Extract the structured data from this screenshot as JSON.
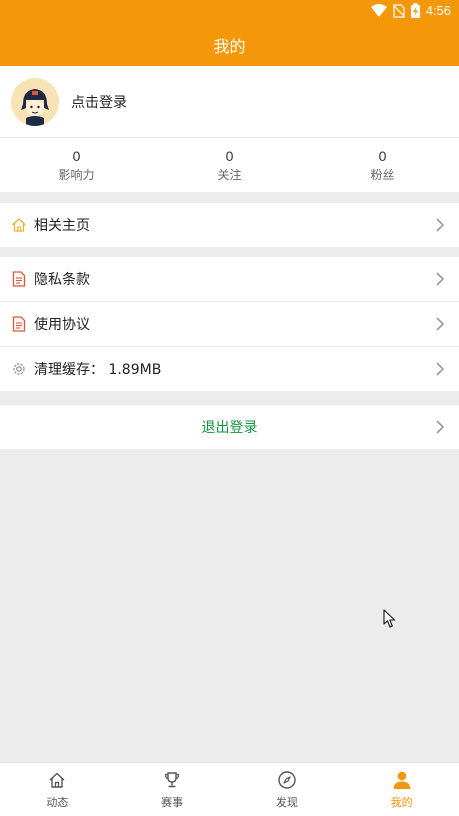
{
  "status_bar": {
    "time": "4:56"
  },
  "header": {
    "title": "我的"
  },
  "profile": {
    "login_prompt": "点击登录"
  },
  "stats": [
    {
      "value": "0",
      "label": "影响力"
    },
    {
      "value": "0",
      "label": "关注"
    },
    {
      "value": "0",
      "label": "粉丝"
    }
  ],
  "menu": {
    "homepage": "相关主页",
    "privacy": "隐私条款",
    "agreement": "使用协议",
    "cache": "清理缓存： 1.89MB",
    "logout": "退出登录"
  },
  "tabs": [
    {
      "label": "动态",
      "icon": "home-icon"
    },
    {
      "label": "赛事",
      "icon": "trophy-icon"
    },
    {
      "label": "发现",
      "icon": "compass-icon"
    },
    {
      "label": "我的",
      "icon": "user-icon"
    }
  ],
  "colors": {
    "accent": "#f49708",
    "logout": "#12933d",
    "doc_icon": "#e2553b",
    "home_icon": "#f0b13a"
  }
}
